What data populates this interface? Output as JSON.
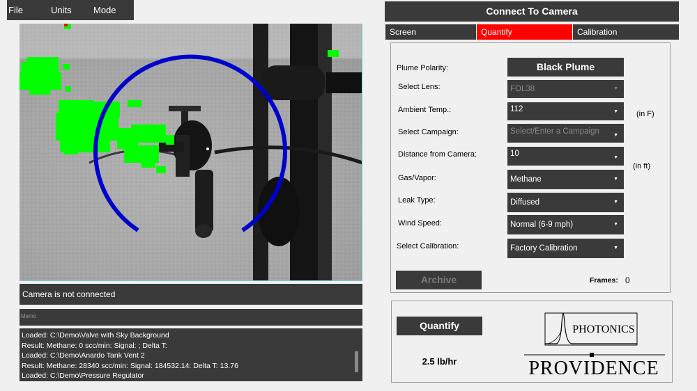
{
  "menu": {
    "items": [
      "File",
      "Units",
      "Mode"
    ]
  },
  "camera": {
    "status": "Camera is not connected"
  },
  "memo": {
    "label": "Memo",
    "lines": [
      "Loaded: C:\\Demo\\Valve with Sky Background",
      "Result: Methane: 0 scc/min: Signal: ; Delta T:",
      "Loaded: C:\\Demo\\Anardo Tank Vent 2",
      "Result: Methane: 28340 scc/min: Signal: 184532.14: Delta T: 13.76",
      "Loaded: C:\\Demo\\Pressure Regulator"
    ]
  },
  "header": {
    "connect_label": "Connect To Camera"
  },
  "tabs": [
    {
      "label": "Screen",
      "active": false
    },
    {
      "label": "Quantify",
      "active": true
    },
    {
      "label": "Calibration",
      "active": false
    }
  ],
  "settings": {
    "plume_polarity": {
      "label": "Plume Polarity:",
      "value": "Black Plume"
    },
    "lens": {
      "label": "Select Lens:",
      "value": "FOL38"
    },
    "ambient_temp": {
      "label": "Ambient Temp.:",
      "value": "112",
      "unit": "(in F)"
    },
    "campaign": {
      "label": "Select Campaign:",
      "placeholder": "Select/Enter a Campaign"
    },
    "distance": {
      "label": "Distance from Camera:",
      "value": "10",
      "unit": "(in ft)"
    },
    "gas": {
      "label": "Gas/Vapor:",
      "value": "Methane"
    },
    "leak_type": {
      "label": "Leak Type:",
      "value": "Diffused"
    },
    "wind_speed": {
      "label": "Wind Speed:",
      "value": "Normal (6-9 mph)"
    },
    "calibration": {
      "label": "Select Calibration:",
      "value": "Factory Calibration"
    },
    "archive_label": "Archive",
    "frames_label": "Frames:",
    "frames_value": "0"
  },
  "quantify": {
    "button_label": "Quantify",
    "result": "2.5 lb/hr"
  },
  "logo": {
    "top_text": "PHOTONICS",
    "bottom_text": "PROVIDENCE"
  },
  "colors": {
    "accent": "#ff0000",
    "panel": "#3a3a3a",
    "overlay_ring": "#0000cc",
    "gas_overlay": "#00ff00"
  }
}
